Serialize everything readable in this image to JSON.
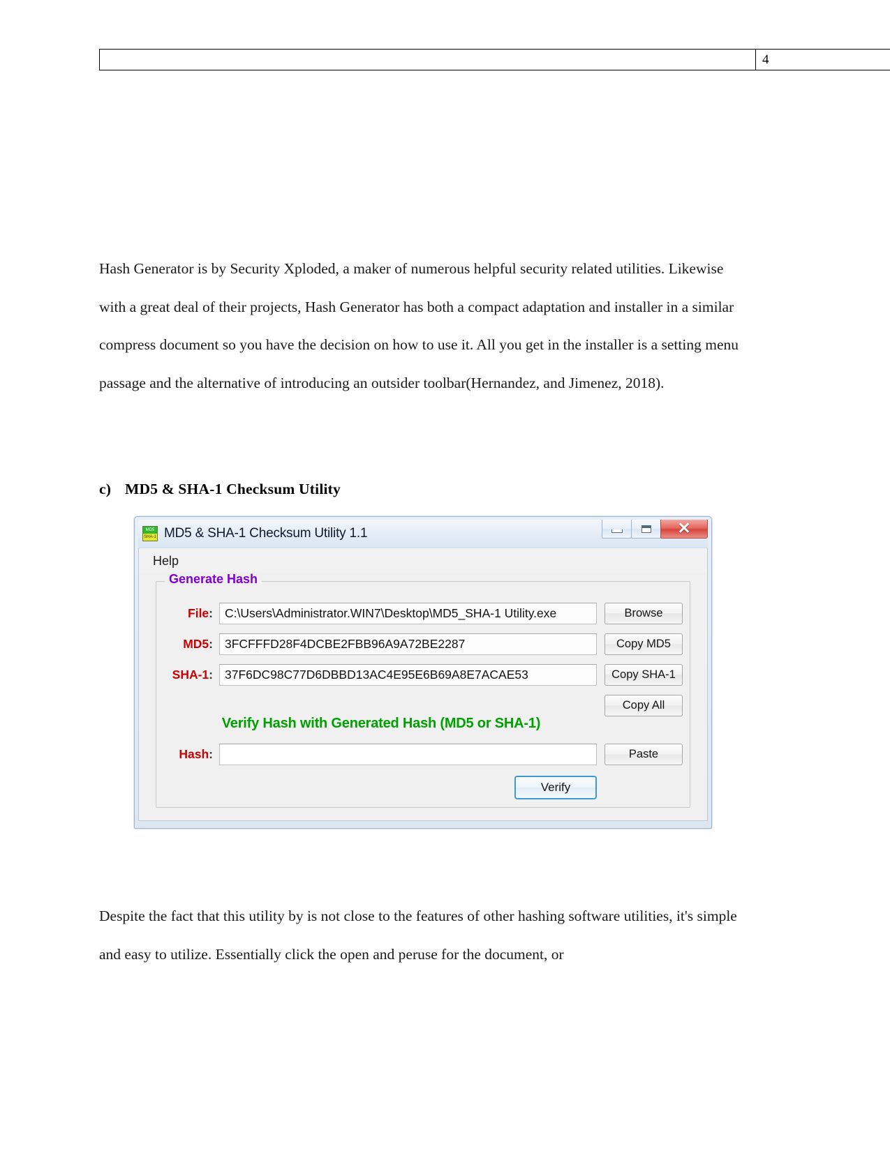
{
  "page": {
    "header": {
      "left_cell": "",
      "page_number": "4"
    },
    "paragraph_top": "Hash Generator is by Security Xploded, a maker of numerous helpful security related utilities. Likewise with a great deal of their projects, Hash Generator has both a compact adaptation and installer in a similar compress document so you have the decision on how to use it. All you get in the installer is a setting menu passage and the alternative of introducing an outsider toolbar(Hernandez, and Jimenez, 2018).",
    "heading": {
      "marker": "c)",
      "text": "MD5 & SHA-1 Checksum Utility"
    },
    "paragraph_bottom": "Despite the fact that this utility by is not close to the features of other hashing software utilities, it's simple and easy to utilize. Essentially click the open and peruse for the document, or"
  },
  "app": {
    "title": "MD5 & SHA-1 Checksum Utility 1.1",
    "icon": {
      "name": "md5-sha1-app-icon",
      "top_label": "MD5",
      "bottom_label": "SHA-1",
      "top_color": "#2eb82e",
      "bottom_color": "#e8e82a"
    },
    "window_controls": {
      "minimize": "minimize-icon",
      "maximize": "maximize-icon",
      "close": "✕"
    },
    "menu": {
      "help": "Help"
    },
    "group": {
      "legend": "Generate Hash",
      "legend_color": "#8000d0"
    },
    "fields": {
      "file": {
        "label": "File",
        "value": "C:\\Users\\Administrator.WIN7\\Desktop\\MD5_SHA-1 Utility.exe",
        "button": "Browse"
      },
      "md5": {
        "label": "MD5",
        "value": "3FCFFFD28F4DCBE2FBB96A9A72BE2287",
        "button": "Copy MD5"
      },
      "sha1": {
        "label": "SHA-1",
        "value": "37F6DC98C77D6DBBD13AC4E95E6B69A8E7ACAE53",
        "button": "Copy SHA-1"
      },
      "hash": {
        "label": "Hash",
        "value": "",
        "button": "Paste"
      }
    },
    "copy_all_button": "Copy All",
    "verify_banner": "Verify Hash with Generated Hash (MD5 or SHA-1)",
    "verify_banner_color": "#00a000",
    "verify_button": "Verify",
    "label_color": "#cc0000"
  }
}
